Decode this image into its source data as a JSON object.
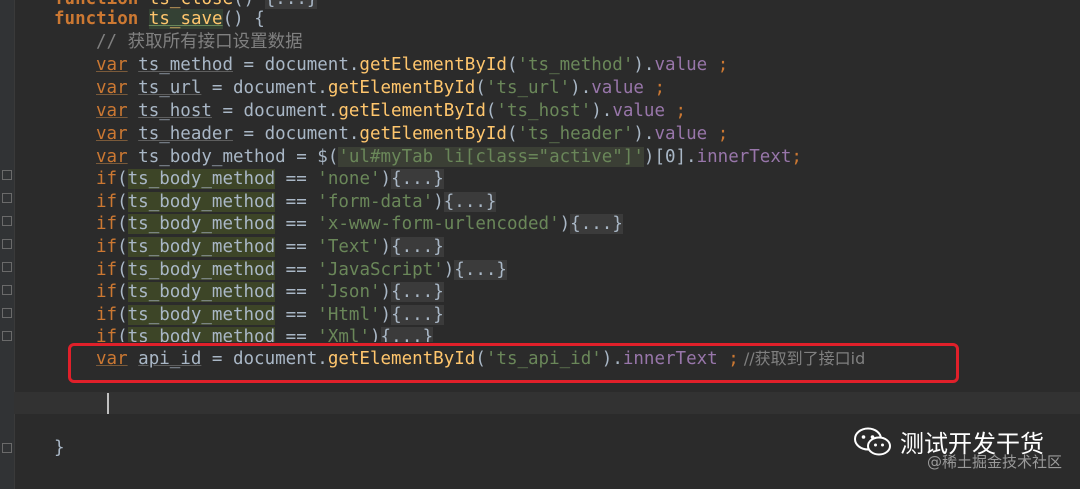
{
  "editor": {
    "lines": {
      "l0": {
        "kw": "function",
        "name": "ts_close",
        "rest": "() ",
        "fold": "{...}"
      },
      "l1": {
        "kw": "function",
        "name": "ts_save",
        "rest": "() {"
      },
      "l2": {
        "comment": "// 获取所有接口设置数据"
      },
      "l3": {
        "var": "var",
        "name": "ts_method",
        "eq": " = document.",
        "fn": "getElementById",
        "open": "(",
        "str": "'ts_method'",
        "close": ").",
        "prop": "value",
        "end": " ;"
      },
      "l4": {
        "var": "var",
        "name": "ts_url",
        "eq": " = document.",
        "fn": "getElementById",
        "open": "(",
        "str": "'ts_url'",
        "close": ").",
        "prop": "value",
        "end": " ;"
      },
      "l5": {
        "var": "var",
        "name": "ts_host",
        "eq": " = document.",
        "fn": "getElementById",
        "open": "(",
        "str": "'ts_host'",
        "close": ").",
        "prop": "value",
        "end": " ;"
      },
      "l6": {
        "var": "var",
        "name": "ts_header",
        "eq": " = document.",
        "fn": "getElementById",
        "open": "(",
        "str": "'ts_header'",
        "close": ").",
        "prop": "value",
        "end": " ;"
      },
      "l7": {
        "var": "var",
        "name": "ts_body_method",
        "eq": " = $(",
        "str": "'ul#myTab li[class=\"active\"]'",
        "close": ")[0].",
        "prop": "innerText",
        "end": ";"
      },
      "ifs": [
        {
          "str": "'none'"
        },
        {
          "str": "'form-data'"
        },
        {
          "str": "'x-www-form-urlencoded'"
        },
        {
          "str": "'Text'"
        },
        {
          "str": "'JavaScript'"
        },
        {
          "str": "'Json'"
        },
        {
          "str": "'Html'"
        },
        {
          "str": "'Xml'"
        }
      ],
      "if_kw": "if",
      "if_open": "(",
      "if_var": "ts_body_method",
      "if_eq": " == ",
      "if_close": ")",
      "if_fold": "{...}",
      "l16": {
        "var": "var",
        "name": "api_id",
        "eq": " = document.",
        "fn": "getElementById",
        "open": "(",
        "str": "'ts_api_id'",
        "close": ").",
        "prop": "innerText",
        "end": " ;",
        "comment": " //获取到了接口id"
      },
      "l18": {
        "brace": "}"
      }
    },
    "colors": {
      "highlight": "#e0202a",
      "background": "#2b2b2b"
    }
  },
  "watermark": {
    "title": "测试开发干货",
    "sub": "@稀土掘金技术社区",
    "icon": "wechat-icon"
  }
}
